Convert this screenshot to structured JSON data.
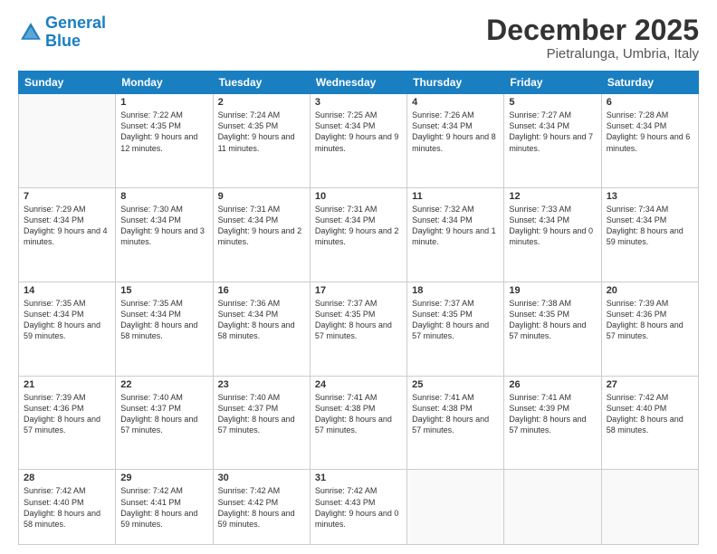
{
  "logo": {
    "line1": "General",
    "line2": "Blue"
  },
  "title": "December 2025",
  "subtitle": "Pietralunga, Umbria, Italy",
  "weekdays": [
    "Sunday",
    "Monday",
    "Tuesday",
    "Wednesday",
    "Thursday",
    "Friday",
    "Saturday"
  ],
  "weeks": [
    [
      {
        "day": "",
        "empty": true
      },
      {
        "day": "1",
        "sunrise": "7:22 AM",
        "sunset": "4:35 PM",
        "daylight": "9 hours and 12 minutes."
      },
      {
        "day": "2",
        "sunrise": "7:24 AM",
        "sunset": "4:35 PM",
        "daylight": "9 hours and 11 minutes."
      },
      {
        "day": "3",
        "sunrise": "7:25 AM",
        "sunset": "4:34 PM",
        "daylight": "9 hours and 9 minutes."
      },
      {
        "day": "4",
        "sunrise": "7:26 AM",
        "sunset": "4:34 PM",
        "daylight": "9 hours and 8 minutes."
      },
      {
        "day": "5",
        "sunrise": "7:27 AM",
        "sunset": "4:34 PM",
        "daylight": "9 hours and 7 minutes."
      },
      {
        "day": "6",
        "sunrise": "7:28 AM",
        "sunset": "4:34 PM",
        "daylight": "9 hours and 6 minutes."
      }
    ],
    [
      {
        "day": "7",
        "sunrise": "7:29 AM",
        "sunset": "4:34 PM",
        "daylight": "9 hours and 4 minutes."
      },
      {
        "day": "8",
        "sunrise": "7:30 AM",
        "sunset": "4:34 PM",
        "daylight": "9 hours and 3 minutes."
      },
      {
        "day": "9",
        "sunrise": "7:31 AM",
        "sunset": "4:34 PM",
        "daylight": "9 hours and 2 minutes."
      },
      {
        "day": "10",
        "sunrise": "7:31 AM",
        "sunset": "4:34 PM",
        "daylight": "9 hours and 2 minutes."
      },
      {
        "day": "11",
        "sunrise": "7:32 AM",
        "sunset": "4:34 PM",
        "daylight": "9 hours and 1 minute."
      },
      {
        "day": "12",
        "sunrise": "7:33 AM",
        "sunset": "4:34 PM",
        "daylight": "9 hours and 0 minutes."
      },
      {
        "day": "13",
        "sunrise": "7:34 AM",
        "sunset": "4:34 PM",
        "daylight": "8 hours and 59 minutes."
      }
    ],
    [
      {
        "day": "14",
        "sunrise": "7:35 AM",
        "sunset": "4:34 PM",
        "daylight": "8 hours and 59 minutes."
      },
      {
        "day": "15",
        "sunrise": "7:35 AM",
        "sunset": "4:34 PM",
        "daylight": "8 hours and 58 minutes."
      },
      {
        "day": "16",
        "sunrise": "7:36 AM",
        "sunset": "4:34 PM",
        "daylight": "8 hours and 58 minutes."
      },
      {
        "day": "17",
        "sunrise": "7:37 AM",
        "sunset": "4:35 PM",
        "daylight": "8 hours and 57 minutes."
      },
      {
        "day": "18",
        "sunrise": "7:37 AM",
        "sunset": "4:35 PM",
        "daylight": "8 hours and 57 minutes."
      },
      {
        "day": "19",
        "sunrise": "7:38 AM",
        "sunset": "4:35 PM",
        "daylight": "8 hours and 57 minutes."
      },
      {
        "day": "20",
        "sunrise": "7:39 AM",
        "sunset": "4:36 PM",
        "daylight": "8 hours and 57 minutes."
      }
    ],
    [
      {
        "day": "21",
        "sunrise": "7:39 AM",
        "sunset": "4:36 PM",
        "daylight": "8 hours and 57 minutes."
      },
      {
        "day": "22",
        "sunrise": "7:40 AM",
        "sunset": "4:37 PM",
        "daylight": "8 hours and 57 minutes."
      },
      {
        "day": "23",
        "sunrise": "7:40 AM",
        "sunset": "4:37 PM",
        "daylight": "8 hours and 57 minutes."
      },
      {
        "day": "24",
        "sunrise": "7:41 AM",
        "sunset": "4:38 PM",
        "daylight": "8 hours and 57 minutes."
      },
      {
        "day": "25",
        "sunrise": "7:41 AM",
        "sunset": "4:38 PM",
        "daylight": "8 hours and 57 minutes."
      },
      {
        "day": "26",
        "sunrise": "7:41 AM",
        "sunset": "4:39 PM",
        "daylight": "8 hours and 57 minutes."
      },
      {
        "day": "27",
        "sunrise": "7:42 AM",
        "sunset": "4:40 PM",
        "daylight": "8 hours and 58 minutes."
      }
    ],
    [
      {
        "day": "28",
        "sunrise": "7:42 AM",
        "sunset": "4:40 PM",
        "daylight": "8 hours and 58 minutes."
      },
      {
        "day": "29",
        "sunrise": "7:42 AM",
        "sunset": "4:41 PM",
        "daylight": "8 hours and 59 minutes."
      },
      {
        "day": "30",
        "sunrise": "7:42 AM",
        "sunset": "4:42 PM",
        "daylight": "8 hours and 59 minutes."
      },
      {
        "day": "31",
        "sunrise": "7:42 AM",
        "sunset": "4:43 PM",
        "daylight": "9 hours and 0 minutes."
      },
      {
        "day": "",
        "empty": true
      },
      {
        "day": "",
        "empty": true
      },
      {
        "day": "",
        "empty": true
      }
    ]
  ]
}
